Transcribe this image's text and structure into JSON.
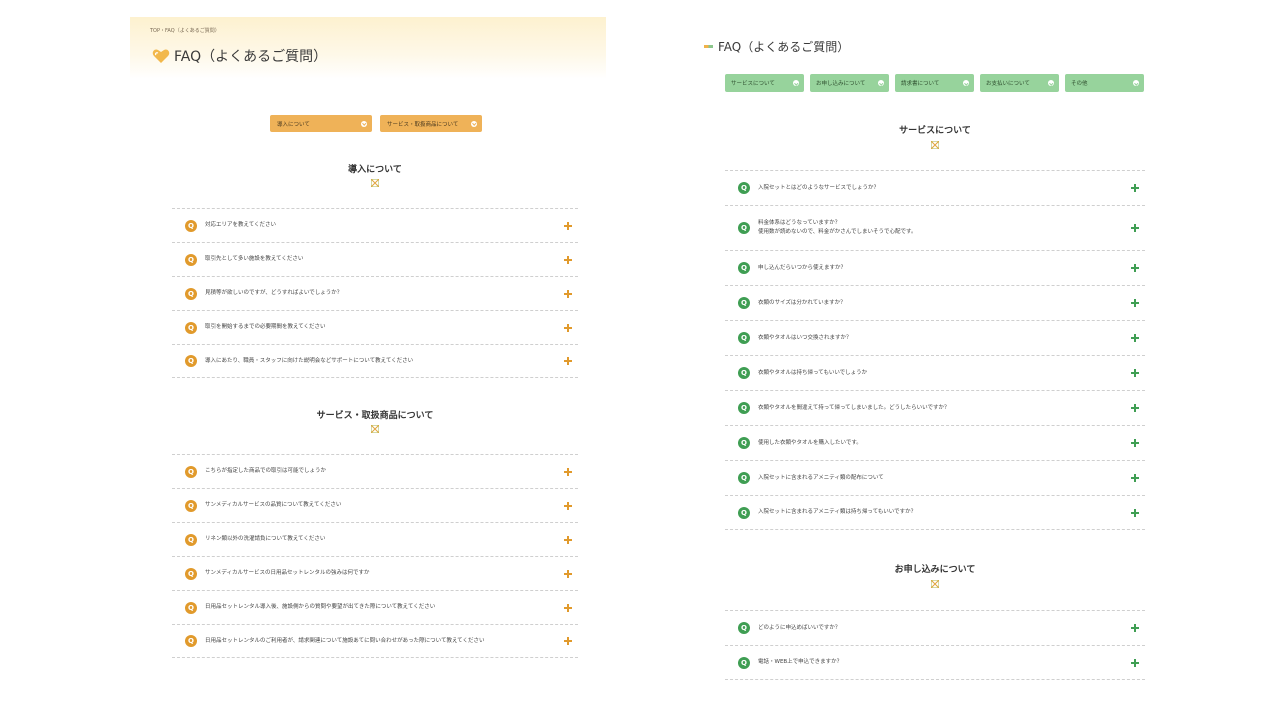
{
  "left": {
    "breadcrumb": "TOP・FAQ（よくあるご質問）",
    "title": "FAQ（よくあるご質問）",
    "tabs": [
      {
        "label": "導入について"
      },
      {
        "label": "サービス・取扱商品について"
      }
    ],
    "sections": [
      {
        "heading": "導入について",
        "questions": [
          "対応エリアを教えてください",
          "取引先として多い施設を教えてください",
          "見積等が欲しいのですが、どうすればよいでしょうか？",
          "取引を開始するまでの必要期間を教えてください",
          "導入にあたり、職員・スタッフに向けた説明会などサポートについて教えてください"
        ]
      },
      {
        "heading": "サービス・取扱商品について",
        "questions": [
          "こちらが指定した商品での取引は可能でしょうか",
          "サンメディカルサービスの品質について教えてください",
          "リネン類以外の洗濯請負について教えてください",
          "サンメディカルサービスの日用品セットレンタルの強みは何ですか",
          "日用品セットレンタル導入後、施設側からの質問や要望が出てきた際について教えてください",
          "日用品セットレンタルのご利用者が、請求関連について施設あてに問い合わせがあった際について教えてください"
        ]
      }
    ]
  },
  "right": {
    "title": "FAQ（よくあるご質問）",
    "tabs": [
      {
        "label": "サービスについて"
      },
      {
        "label": "お申し込みについて"
      },
      {
        "label": "請求書について"
      },
      {
        "label": "お支払いについて"
      },
      {
        "label": "その他"
      }
    ],
    "sections": [
      {
        "heading": "サービスについて",
        "questions": [
          {
            "line1": "入院セットとはどのようなサービスでしょうか？",
            "line2": ""
          },
          {
            "line1": "料金体系はどうなっていますか？",
            "line2": "使用数が読めないので、料金がかさんでしまいそうで心配です。"
          },
          {
            "line1": "申し込んだらいつから使えますか？",
            "line2": ""
          },
          {
            "line1": "衣類のサイズは分かれていますか？",
            "line2": ""
          },
          {
            "line1": "衣類やタオルはいつ交換されますか？",
            "line2": ""
          },
          {
            "line1": "衣類やタオルは持ち帰ってもいいでしょうか",
            "line2": ""
          },
          {
            "line1": "衣類やタオルを間違えて持って帰ってしまいました。どうしたらいいですか？",
            "line2": ""
          },
          {
            "line1": "使用した衣類やタオルを購入したいです。",
            "line2": ""
          },
          {
            "line1": "入院セットに含まれるアメニティ類の配布について",
            "line2": ""
          },
          {
            "line1": "入院セットに含まれるアメニティ類は持ち帰ってもいいですか？",
            "line2": ""
          }
        ]
      },
      {
        "heading": "お申し込みについて",
        "questions": [
          {
            "line1": "どのように申込めばいいですか？",
            "line2": ""
          },
          {
            "line1": "電話・WEB上で申込できますか？",
            "line2": ""
          }
        ]
      }
    ]
  },
  "colors": {
    "left_accent": "#e19a2c",
    "left_tab": "#efb258",
    "right_accent": "#3f9e53",
    "right_tab": "#97d39c"
  },
  "icons": {
    "question": "Q",
    "expand": "plus-icon",
    "heart": "heart-icon",
    "section_deco": "checker-deco-icon"
  }
}
